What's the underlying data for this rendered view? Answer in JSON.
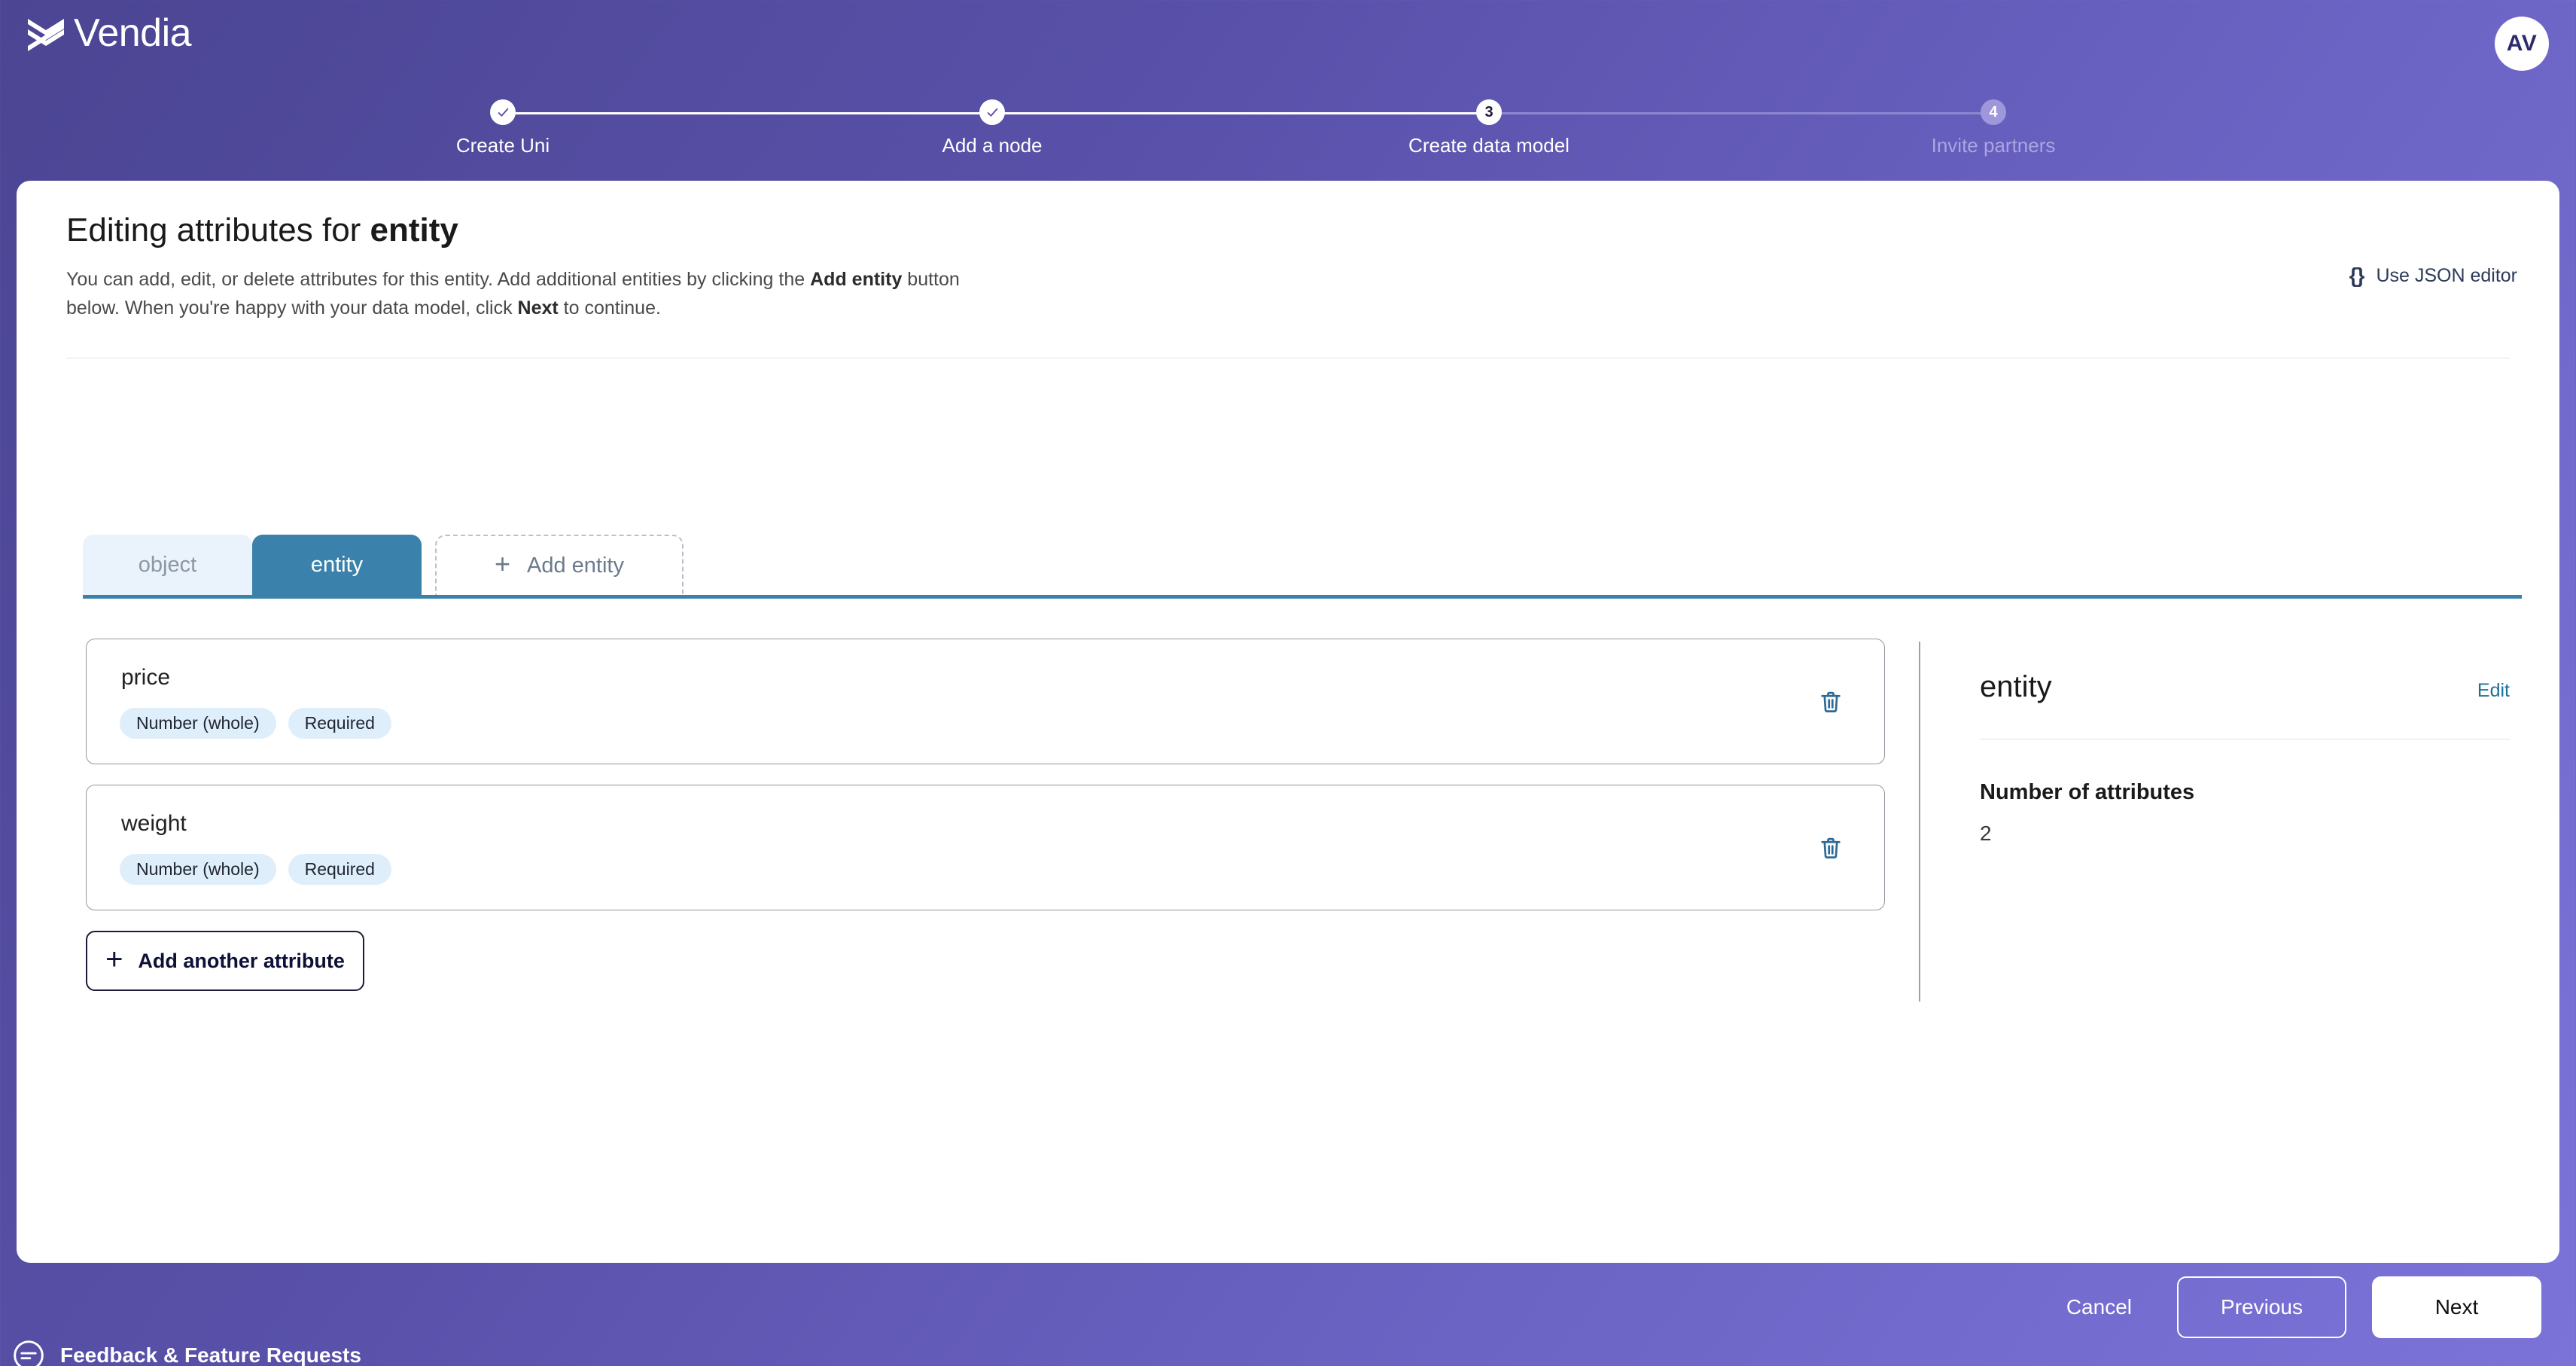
{
  "brand": {
    "name": "Vendia",
    "logo_icon": "vendia-braid-icon"
  },
  "account": {
    "avatar_initials": "AV"
  },
  "stepper": {
    "steps": [
      {
        "number": "1",
        "label": "Create Uni",
        "state": "complete"
      },
      {
        "number": "2",
        "label": "Add a node",
        "state": "complete"
      },
      {
        "number": "3",
        "label": "Create data model",
        "state": "current"
      },
      {
        "number": "4",
        "label": "Invite partners",
        "state": "upcoming"
      }
    ]
  },
  "header": {
    "title_prefix": "Editing attributes for ",
    "title_entity": "entity",
    "desc_line1_a": "You can add, edit, or delete attributes for this entity. Add additional entities by clicking the ",
    "desc_bold1": "Add entity",
    "desc_line2_a": " button below. When you're happy with your data model, click ",
    "desc_bold2": "Next",
    "desc_line2_b": " to continue.",
    "json_editor_glyph": "{}",
    "json_editor_label": "Use JSON editor"
  },
  "tabs": {
    "items": [
      {
        "label": "object",
        "state": "inactive"
      },
      {
        "label": "entity",
        "state": "active"
      }
    ],
    "add_label": "Add entity",
    "add_plus": "+"
  },
  "attributes": {
    "items": [
      {
        "name": "price",
        "badges": [
          "Number (whole)",
          "Required"
        ],
        "delete_icon": "trash-icon"
      },
      {
        "name": "weight",
        "badges": [
          "Number (whole)",
          "Required"
        ],
        "delete_icon": "trash-icon"
      }
    ],
    "add_button_plus": "+",
    "add_button_label": "Add another attribute"
  },
  "details_panel": {
    "title": "entity",
    "edit_label": "Edit",
    "field_label": "Number of attributes",
    "field_value": "2"
  },
  "footer": {
    "cancel_label": "Cancel",
    "previous_label": "Previous",
    "next_label": "Next",
    "feedback_label": "Feedback & Feature Requests",
    "feedback_icon": "feedback-circle-icon"
  },
  "colors": {
    "background_start": "#4b4593",
    "background_end": "#7b73d8",
    "tab_active": "#3a82ab",
    "tab_inactive_bg": "#eaf2fb",
    "badge_bg": "#dfeefb",
    "link_blue": "#1f6f9c",
    "dark_navy": "#0d1136"
  }
}
